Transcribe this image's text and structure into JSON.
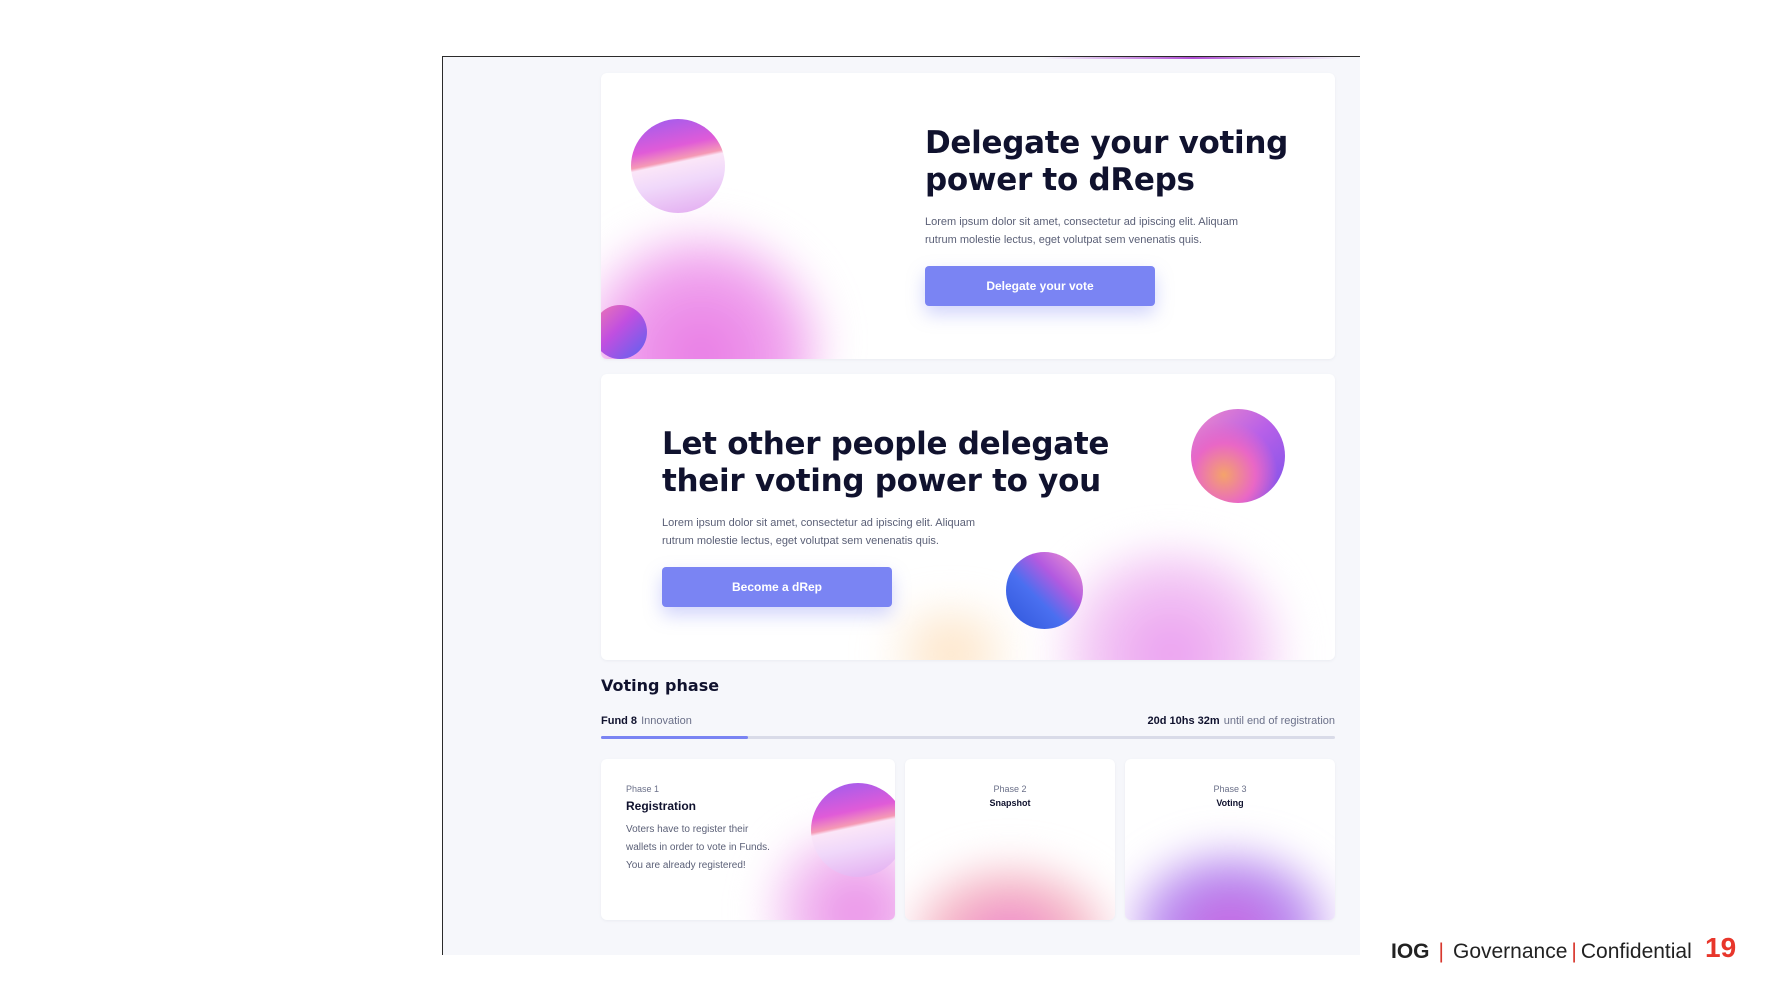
{
  "hero_delegate": {
    "title_line1": "Delegate your voting",
    "title_line2": "power to dReps",
    "text_line1": "Lorem ipsum dolor sit amet, consectetur ad ipiscing elit. Aliquam",
    "text_line2": "rutrum molestie lectus, eget volutpat sem venenatis quis.",
    "button_label": "Delegate your vote"
  },
  "hero_drep": {
    "title_line1": "Let other people delegate",
    "title_line2": "their voting power to you",
    "text_line1": "Lorem ipsum dolor sit amet, consectetur ad ipiscing elit. Aliquam",
    "text_line2": "rutrum molestie lectus, eget volutpat sem venenatis quis.",
    "button_label": "Become a dRep"
  },
  "voting": {
    "section_title": "Voting phase",
    "fund_label": "Fund 8",
    "fund_category": "Innovation",
    "countdown_value": "20d 10hs 32m",
    "countdown_suffix": "until end of registration",
    "progress_percent": 20,
    "phases": [
      {
        "number_label": "Phase 1",
        "name": "Registration",
        "desc_line1": "Voters have to register their",
        "desc_line2": "wallets in order to vote in Funds.",
        "desc_line3": "You are already registered!"
      },
      {
        "number_label": "Phase 2",
        "name": "Snapshot"
      },
      {
        "number_label": "Phase 3",
        "name": "Voting"
      }
    ]
  },
  "footer": {
    "brand": "IOG",
    "separator": "|",
    "section": "Governance",
    "classification": "Confidential",
    "page_number": "19"
  },
  "colors": {
    "accent": "#7a84f3",
    "heading": "#10122e",
    "footer_red": "#e8362b"
  }
}
